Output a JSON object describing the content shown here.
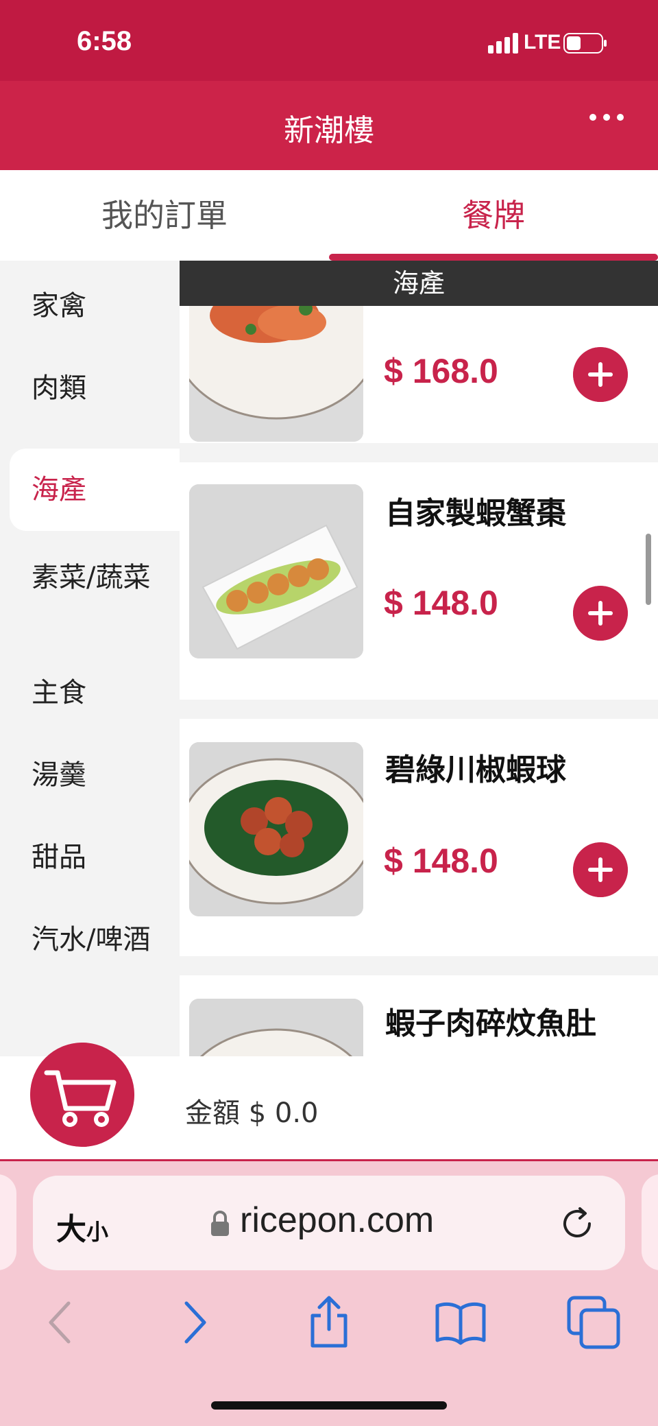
{
  "status_bar": {
    "time": "6:58",
    "network": "LTE"
  },
  "header": {
    "title": "新潮樓"
  },
  "tabs": [
    {
      "label": "我的訂單"
    },
    {
      "label": "餐牌"
    }
  ],
  "sidebar": {
    "categories": [
      {
        "label": "家禽"
      },
      {
        "label": "肉類"
      },
      {
        "label": "海產"
      },
      {
        "label": "素菜/蔬菜"
      },
      {
        "label": "主食"
      },
      {
        "label": "湯羹"
      },
      {
        "label": "甜品"
      },
      {
        "label": "汽水/啤酒"
      }
    ],
    "active_index": 2
  },
  "section": {
    "title": "海產"
  },
  "menu_items": [
    {
      "name": "",
      "price": "$ 168.0"
    },
    {
      "name": "自家製蝦蟹棗",
      "price": "$ 148.0"
    },
    {
      "name": "碧綠川椒蝦球",
      "price": "$ 148.0"
    },
    {
      "name": "蝦子肉碎炆魚肚",
      "price": ""
    }
  ],
  "cart": {
    "total_label": "金額 $ 0.0"
  },
  "browser": {
    "text_size_big": "大",
    "text_size_small": "小",
    "url": "ricepon.com"
  },
  "colors": {
    "brand": "#c8234b",
    "status_bar": "#c01a42",
    "browser_bg": "#f5c9d3"
  },
  "icons": [
    "more-icon",
    "cart-icon",
    "plus-icon",
    "lock-icon",
    "reload-icon",
    "back-icon",
    "forward-icon",
    "share-icon",
    "bookmarks-icon",
    "tabs-icon"
  ]
}
